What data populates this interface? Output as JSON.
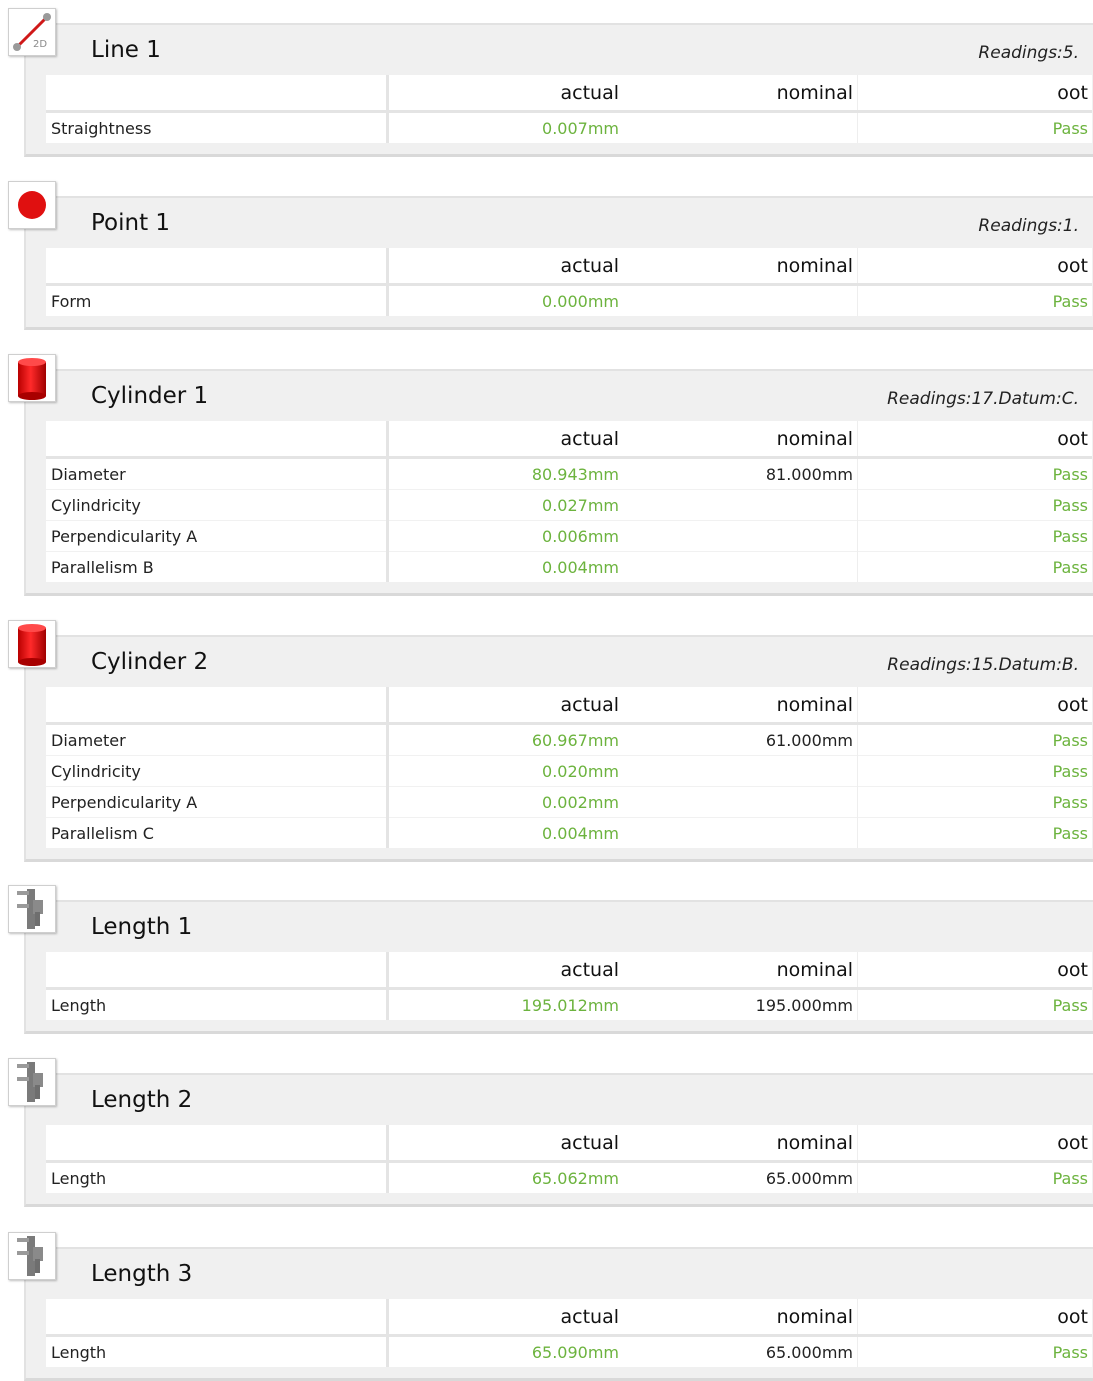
{
  "columns": {
    "actual": "actual",
    "nominal": "nominal",
    "oot": "oot"
  },
  "colors": {
    "pass": "#6cb33e",
    "panel": "#f0f0f0",
    "feature_red": "#e01010"
  },
  "features": [
    {
      "title": "Line 1",
      "icon": "line-2d-icon",
      "readings": "Readings:5.",
      "rows": [
        {
          "name": "Straightness",
          "actual": "0.007mm",
          "nominal": "",
          "oot": "Pass"
        }
      ]
    },
    {
      "title": "Point 1",
      "icon": "point-icon",
      "readings": "Readings:1.",
      "rows": [
        {
          "name": "Form",
          "actual": "0.000mm",
          "nominal": "",
          "oot": "Pass"
        }
      ]
    },
    {
      "title": "Cylinder 1",
      "icon": "cylinder-icon",
      "readings": "Readings:17.Datum:C.",
      "rows": [
        {
          "name": "Diameter",
          "actual": "80.943mm",
          "nominal": "81.000mm",
          "oot": "Pass"
        },
        {
          "name": "Cylindricity",
          "actual": "0.027mm",
          "nominal": "",
          "oot": "Pass"
        },
        {
          "name": "Perpendicularity A",
          "actual": "0.006mm",
          "nominal": "",
          "oot": "Pass"
        },
        {
          "name": "Parallelism B",
          "actual": "0.004mm",
          "nominal": "",
          "oot": "Pass"
        }
      ]
    },
    {
      "title": "Cylinder 2",
      "icon": "cylinder-icon",
      "readings": "Readings:15.Datum:B.",
      "rows": [
        {
          "name": "Diameter",
          "actual": "60.967mm",
          "nominal": "61.000mm",
          "oot": "Pass"
        },
        {
          "name": "Cylindricity",
          "actual": "0.020mm",
          "nominal": "",
          "oot": "Pass"
        },
        {
          "name": "Perpendicularity A",
          "actual": "0.002mm",
          "nominal": "",
          "oot": "Pass"
        },
        {
          "name": "Parallelism C",
          "actual": "0.004mm",
          "nominal": "",
          "oot": "Pass"
        }
      ]
    },
    {
      "title": "Length 1",
      "icon": "caliper-icon",
      "readings": "",
      "rows": [
        {
          "name": "Length",
          "actual": "195.012mm",
          "nominal": "195.000mm",
          "oot": "Pass"
        }
      ]
    },
    {
      "title": "Length 2",
      "icon": "caliper-icon",
      "readings": "",
      "rows": [
        {
          "name": "Length",
          "actual": "65.062mm",
          "nominal": "65.000mm",
          "oot": "Pass"
        }
      ]
    },
    {
      "title": "Length 3",
      "icon": "caliper-icon",
      "readings": "",
      "rows": [
        {
          "name": "Length",
          "actual": "65.090mm",
          "nominal": "65.000mm",
          "oot": "Pass"
        }
      ]
    }
  ]
}
